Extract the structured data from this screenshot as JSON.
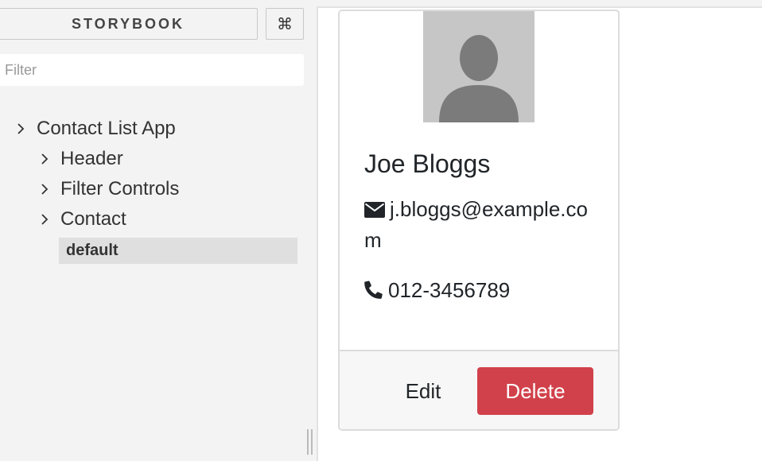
{
  "sidebar": {
    "brand_label": "STORYBOOK",
    "shortcut_glyph": "⌘",
    "filter": {
      "placeholder": "Filter",
      "value": ""
    },
    "tree": {
      "root": "Contact List App",
      "items": [
        "Header",
        "Filter Controls",
        "Contact"
      ],
      "selected_story": "default"
    }
  },
  "preview": {
    "contact": {
      "name": "Joe Bloggs",
      "email": "j.bloggs@example.com",
      "phone": "012-3456789"
    },
    "actions": {
      "edit_label": "Edit",
      "delete_label": "Delete"
    }
  },
  "colors": {
    "sidebar_bg": "#f3f3f3",
    "selected_bg": "#dfdfdf",
    "danger": "#d1414b",
    "avatar_bg": "#c6c6c6",
    "avatar_fg": "#7b7b7b"
  },
  "icons": {
    "email": "envelope-icon",
    "phone": "phone-icon",
    "chevron": "chevron-right-icon",
    "avatar": "user-silhouette-icon"
  }
}
